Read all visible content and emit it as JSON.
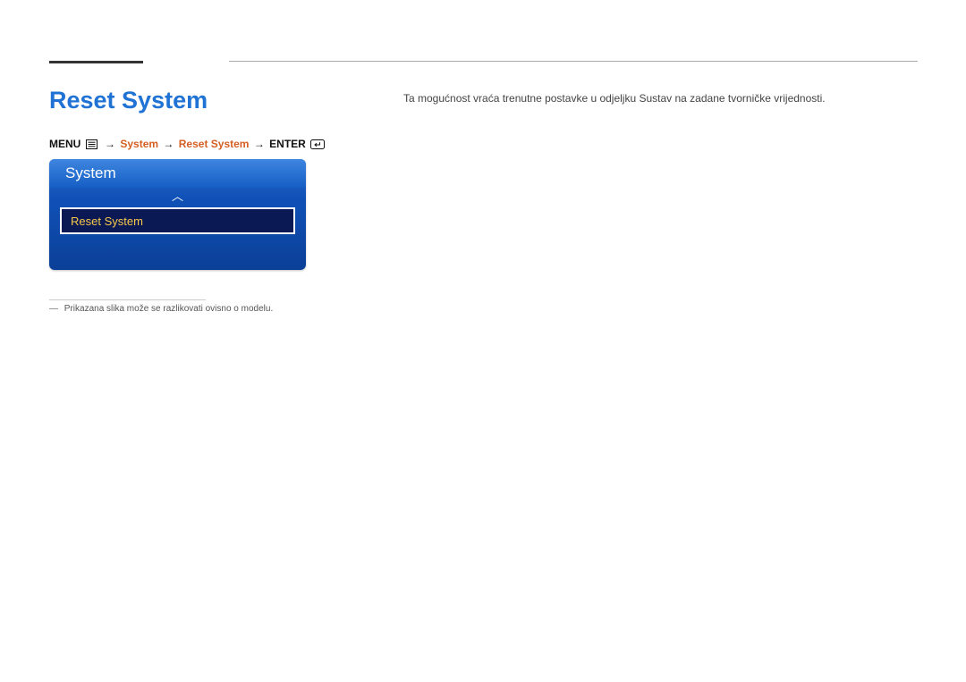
{
  "title": "Reset System",
  "description": "Ta mogućnost vraća trenutne postavke u odjeljku Sustav na zadane tvorničke vrijednosti.",
  "breadcrumb": {
    "menu": "MENU",
    "system": "System",
    "reset": "Reset System",
    "enter": "ENTER",
    "arrow": "→"
  },
  "osd": {
    "panel_title": "System",
    "scroll_up_icon": "︿",
    "selected_item": "Reset System"
  },
  "footnote": {
    "dash": "―",
    "text": "Prikazana slika može se razlikovati ovisno o modelu."
  }
}
